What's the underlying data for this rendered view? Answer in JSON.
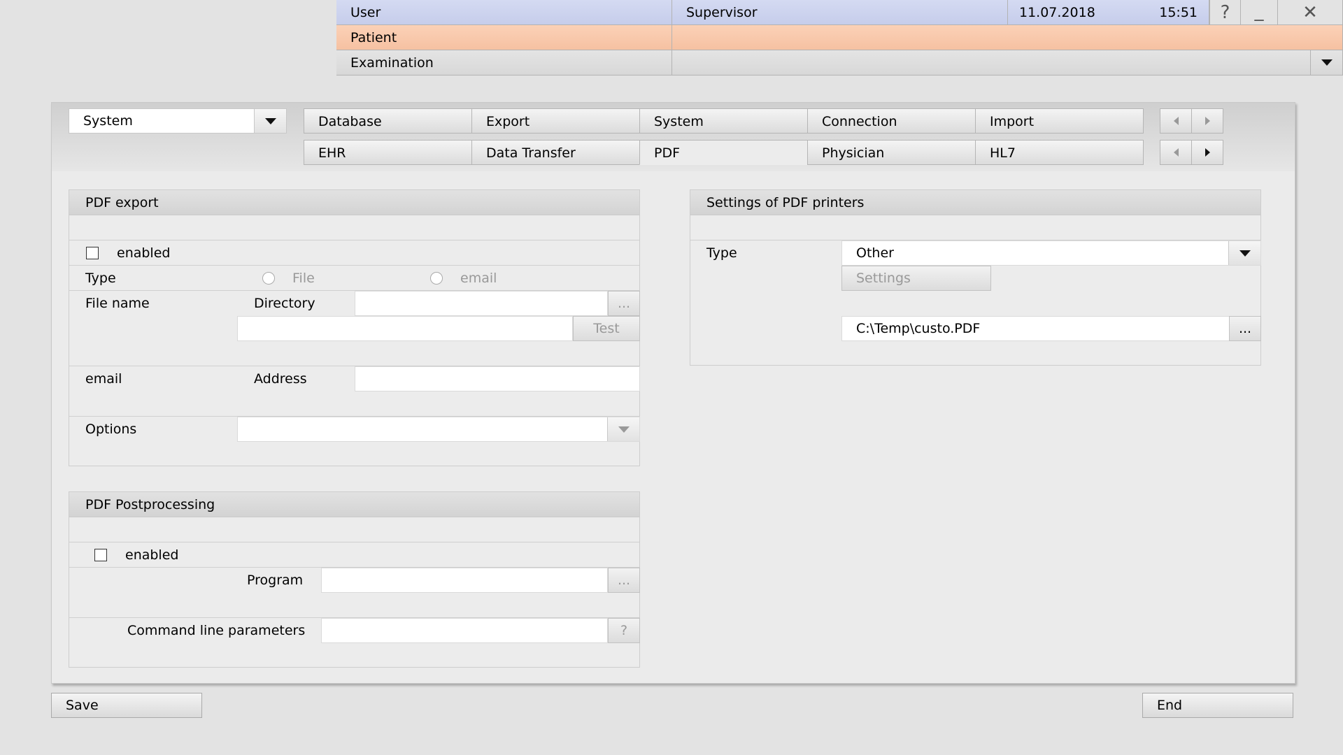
{
  "header": {
    "user_label": "User",
    "user_value": "Supervisor",
    "date": "11.07.2018",
    "time": "15:51",
    "help_glyph": "?",
    "minimize_glyph": "_",
    "close_glyph": "✕",
    "patient_label": "Patient",
    "patient_value": "",
    "examination_label": "Examination",
    "examination_value": ""
  },
  "category_select": {
    "value": "System"
  },
  "tabs": {
    "row1": [
      "Database",
      "Export",
      "System",
      "Connection",
      "Import"
    ],
    "row2": [
      "EHR",
      "Data Transfer",
      "PDF",
      "Physician",
      "HL7"
    ],
    "active": "PDF"
  },
  "pdf_export": {
    "title": "PDF export",
    "enabled_label": "enabled",
    "enabled": false,
    "type_label": "Type",
    "type_options": [
      "File",
      "email"
    ],
    "file_name_label": "File name",
    "directory_label": "Directory",
    "directory_value": "",
    "file_name_value": "",
    "browse_label": "...",
    "test_label": "Test",
    "email_label": "email",
    "address_label": "Address",
    "address_value": "",
    "options_label": "Options",
    "options_value": ""
  },
  "pdf_postprocessing": {
    "title": "PDF Postprocessing",
    "enabled_label": "enabled",
    "enabled": false,
    "program_label": "Program",
    "program_value": "",
    "browse_label": "...",
    "cmd_label": "Command line parameters",
    "cmd_value": "",
    "help_label": "?"
  },
  "pdf_printers": {
    "title": "Settings of PDF printers",
    "type_label": "Type",
    "type_value": "Other",
    "settings_label": "Settings",
    "path_value": "C:\\Temp\\custo.PDF",
    "browse_label": "..."
  },
  "footer": {
    "save_label": "Save",
    "end_label": "End"
  },
  "colors": {
    "user_row": "#c9d0ee",
    "patient_row": "#f8c6a8",
    "background": "#e3e3e3"
  }
}
